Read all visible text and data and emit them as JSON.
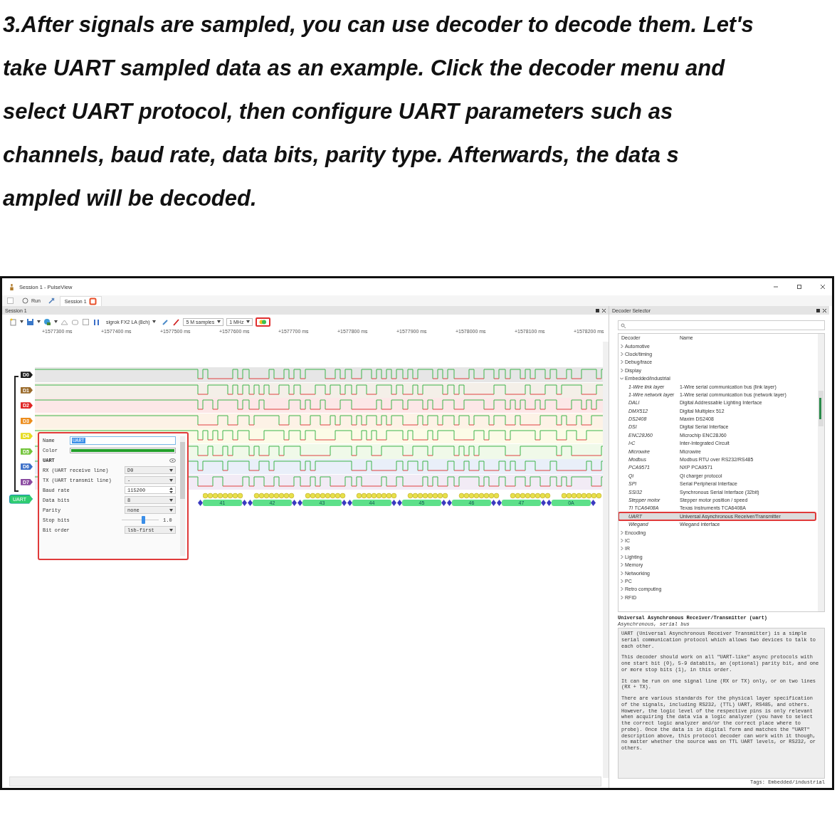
{
  "instruction": {
    "lines": [
      "3.After signals are sampled, you can use decoder to decode them. Let's",
      "take UART sampled data as an example. Click the decoder menu and",
      "select UART protocol, then configure UART parameters such as",
      "channels, baud rate, data bits, parity type. Afterwards, the data s",
      "ampled will be decoded."
    ]
  },
  "window": {
    "title": "Session 1 - PulseView"
  },
  "toolbar": {
    "run": "Run",
    "tab": "Session 1"
  },
  "session": {
    "title": "Session 1",
    "device": "sigrok FX2 LA (8ch)",
    "samples": "5 M samples",
    "rate": "1 MHz"
  },
  "ruler": [
    "+1577300 ms",
    "+1577400 ms",
    "+1577500 ms",
    "+1577600 ms",
    "+1577700 ms",
    "+1577800 ms",
    "+1577900 ms",
    "+1578000 ms",
    "+1578100 ms",
    "+1578200 ms"
  ],
  "channels": [
    {
      "label": "D0",
      "color": "#1c1c1c"
    },
    {
      "label": "D1",
      "color": "#9a6a2a"
    },
    {
      "label": "D2",
      "color": "#e02424"
    },
    {
      "label": "D3",
      "color": "#ec8c1c"
    },
    {
      "label": "D4",
      "color": "#e6dc22"
    },
    {
      "label": "D5",
      "color": "#72c43a"
    },
    {
      "label": "D6",
      "color": "#3a6ec8"
    },
    {
      "label": "D7",
      "color": "#8a4aa0"
    }
  ],
  "decoder_trace": {
    "label": "UART",
    "annotations": [
      "41",
      "42",
      "43",
      "44",
      "45",
      "46",
      "47",
      "0A"
    ]
  },
  "decoder_settings": {
    "name_label": "Name",
    "name_value": "UART",
    "color_label": "Color",
    "heading": "UART",
    "options": [
      {
        "kind": "select",
        "label": "RX (UART receive line)",
        "value": "D0"
      },
      {
        "kind": "select",
        "label": "TX (UART transmit line)",
        "value": "-"
      },
      {
        "kind": "spin",
        "label": "Baud rate",
        "value": "115200"
      },
      {
        "kind": "select",
        "label": "Data bits",
        "value": "8"
      },
      {
        "kind": "select",
        "label": "Parity",
        "value": "none"
      },
      {
        "kind": "slider",
        "label": "Stop bits",
        "value": "1.0",
        "level": 0.6
      },
      {
        "kind": "select",
        "label": "Bit order",
        "value": "lsb-first"
      }
    ]
  },
  "decoder_selector": {
    "title": "Decoder Selector",
    "columns": [
      "Decoder",
      "Name"
    ],
    "categories": [
      {
        "label": "Automotive",
        "expanded": false
      },
      {
        "label": "Clock/timing",
        "expanded": false
      },
      {
        "label": "Debug/trace",
        "expanded": false
      },
      {
        "label": "Display",
        "expanded": false
      },
      {
        "label": "Embedded/industrial",
        "expanded": true,
        "children": [
          {
            "decoder": "1-Wire link layer",
            "name": "1-Wire serial communication bus (link layer)",
            "selected": false
          },
          {
            "decoder": "1-Wire network layer",
            "name": "1-Wire serial communication bus (network layer)",
            "selected": false
          },
          {
            "decoder": "DALI",
            "name": "Digital Addressable Lighting Interface",
            "selected": false
          },
          {
            "decoder": "DMX512",
            "name": "Digital Multiplex 512",
            "selected": false
          },
          {
            "decoder": "DS2408",
            "name": "Maxim DS2408",
            "selected": false
          },
          {
            "decoder": "DSI",
            "name": "Digital Serial Interface",
            "selected": false
          },
          {
            "decoder": "ENC28J60",
            "name": "Microchip ENC28J60",
            "selected": false
          },
          {
            "decoder": "I²C",
            "name": "Inter-Integrated Circuit",
            "selected": false
          },
          {
            "decoder": "Microwire",
            "name": "Microwire",
            "selected": false
          },
          {
            "decoder": "Modbus",
            "name": "Modbus RTU over RS232/RS485",
            "selected": false
          },
          {
            "decoder": "PCA9571",
            "name": "NXP PCA9571",
            "selected": false
          },
          {
            "decoder": "Qi",
            "name": "Qi charger protocol",
            "selected": false
          },
          {
            "decoder": "SPI",
            "name": "Serial Peripheral Interface",
            "selected": false
          },
          {
            "decoder": "SSI32",
            "name": "Synchronous Serial Interface (32bit)",
            "selected": false
          },
          {
            "decoder": "Stepper motor",
            "name": "Stepper motor position / speed",
            "selected": false
          },
          {
            "decoder": "TI TCA6408A",
            "name": "Texas Instruments TCA6408A",
            "selected": false
          },
          {
            "decoder": "UART",
            "name": "Universal Asynchronous Receiver/Transmitter",
            "selected": true
          },
          {
            "decoder": "Wiegand",
            "name": "Wiegand interface",
            "selected": false
          }
        ]
      },
      {
        "label": "Encoding",
        "expanded": false
      },
      {
        "label": "IC",
        "expanded": false
      },
      {
        "label": "IR",
        "expanded": false
      },
      {
        "label": "Lighting",
        "expanded": false
      },
      {
        "label": "Memory",
        "expanded": false
      },
      {
        "label": "Networking",
        "expanded": false
      },
      {
        "label": "PC",
        "expanded": false
      },
      {
        "label": "Retro computing",
        "expanded": false
      },
      {
        "label": "RFID",
        "expanded": false
      }
    ]
  },
  "description": {
    "title": "Universal Asynchronous Receiver/Transmitter (uart)",
    "subtitle": "Asynchronous, serial bus",
    "paragraphs": [
      "UART (Universal Asynchronous Receiver Transmitter) is a simple serial communication protocol which allows two devices to talk to each other.",
      "This decoder should work on all \"UART-like\" async protocols with one start bit (0), 5-9 databits, an (optional) parity bit, and one or more stop bits (1), in this order.",
      "It can be run on one signal line (RX or TX) only, or on two lines (RX + TX).",
      "There are various standards for the physical layer specification of the signals, including RS232, (TTL) UART, RS485, and others. However, the logic level of the respective pins is only relevant when acquiring the data via a logic analyzer (you have to select the correct logic analyzer and/or the correct place where to probe). Once the data is in digital form and matches the \"UART\" description above, this protocol decoder can work with it though, no matter whether the source was on TTL UART levels, or RS232, or others."
    ],
    "tags": "Tags: Embedded/industrial"
  }
}
